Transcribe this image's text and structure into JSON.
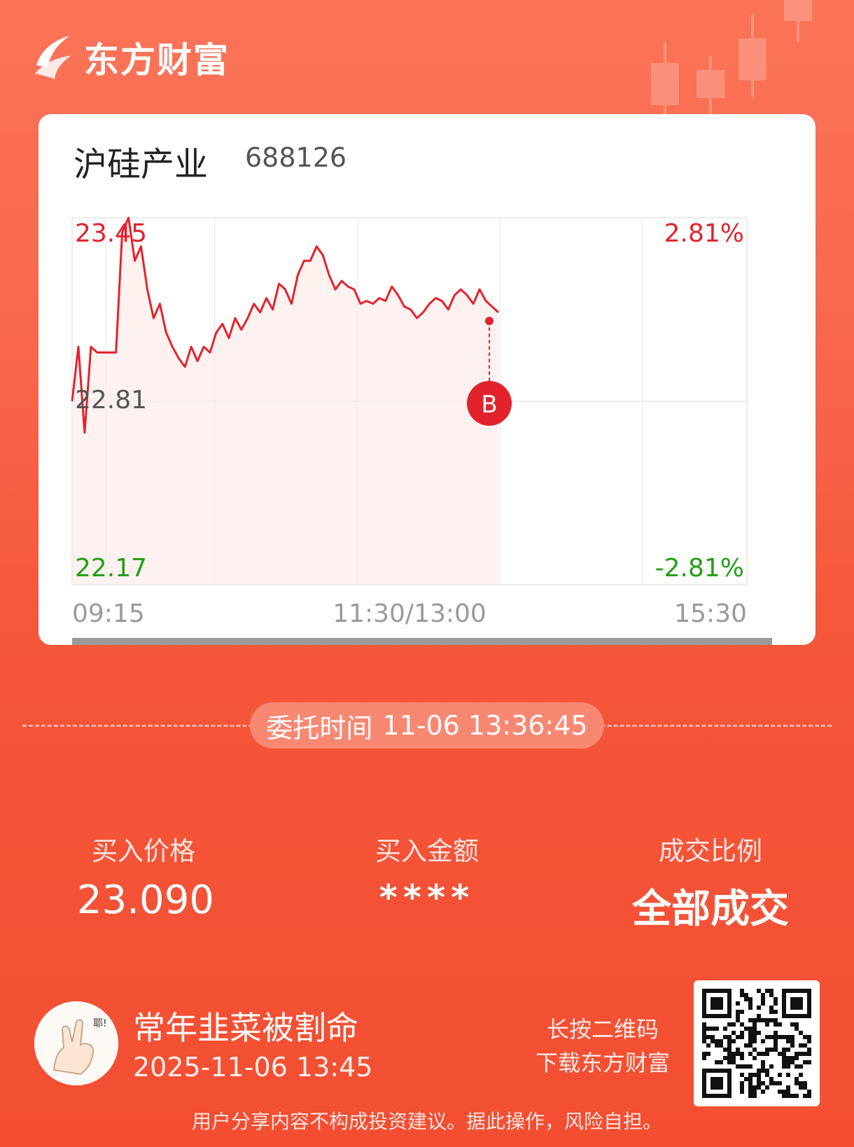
{
  "brand": {
    "name": "东方财富"
  },
  "stock": {
    "name": "沪硅产业",
    "code": "688126"
  },
  "chart_data": {
    "type": "line",
    "title": "",
    "xlabel": "",
    "ylabel": "",
    "x_ticks": [
      "09:15",
      "11:30/13:00",
      "15:30"
    ],
    "ylim": [
      22.17,
      23.45
    ],
    "y_left_labels": {
      "high": "23.45",
      "mid": "22.81",
      "low": "22.17"
    },
    "y_right_labels": {
      "high": "2.81%",
      "low": "-2.81%"
    },
    "prev_close": 22.81,
    "series": [
      {
        "values": [
          22.81,
          23.0,
          22.7,
          23.0,
          22.98,
          22.98,
          22.98,
          22.98,
          23.4,
          23.45,
          23.3,
          23.35,
          23.2,
          23.1,
          23.15,
          23.05,
          23.0,
          22.96,
          22.93,
          23.0,
          22.95,
          23.0,
          22.98,
          23.05,
          23.08,
          23.03,
          23.1,
          23.06,
          23.1,
          23.15,
          23.12,
          23.17,
          23.13,
          23.22,
          23.2,
          23.15,
          23.25,
          23.3,
          23.3,
          23.35,
          23.32,
          23.25,
          23.2,
          23.23,
          23.21,
          23.2,
          23.15,
          23.16,
          23.15,
          23.17,
          23.16,
          23.21,
          23.18,
          23.14,
          23.13,
          23.1,
          23.12,
          23.15,
          23.17,
          23.16,
          23.13,
          23.18,
          23.2,
          23.18,
          23.15,
          23.2,
          23.16,
          23.14,
          23.12
        ]
      }
    ],
    "trade_marker": {
      "label": "B",
      "price": 23.09
    }
  },
  "order": {
    "time_label": "委托时间",
    "time_value": "11-06 13:36:45"
  },
  "stats": [
    {
      "label": "买入价格",
      "value": "23.090"
    },
    {
      "label": "买入金额",
      "value": "****"
    },
    {
      "label": "成交比例",
      "value": "全部成交"
    }
  ],
  "user": {
    "name": "常年韭菜被割命",
    "share_time": "2025-11-06 13:45",
    "avatar_text": "耶!"
  },
  "qr": {
    "hint_line1": "长按二维码",
    "hint_line2": "下载东方财富"
  },
  "disclaimer": "用户分享内容不构成投资建议。据此操作，风险自担。",
  "colors": {
    "up": "#e2232b",
    "down": "#22a015",
    "accent": "#f5573a"
  }
}
